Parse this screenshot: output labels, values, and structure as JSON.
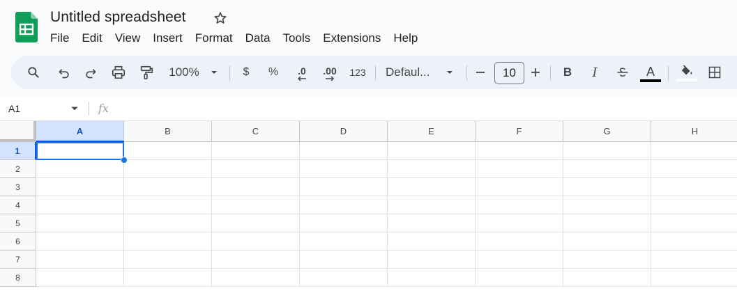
{
  "document": {
    "title": "Untitled spreadsheet"
  },
  "menu": [
    "File",
    "Edit",
    "View",
    "Insert",
    "Format",
    "Data",
    "Tools",
    "Extensions",
    "Help"
  ],
  "toolbar": {
    "zoom": "100%",
    "currency": "$",
    "percent": "%",
    "decrease_decimal": ".0",
    "increase_decimal": ".00",
    "number_format": "123",
    "font": "Defaul...",
    "font_size": "10",
    "minus": "−",
    "plus": "+",
    "bold": "B",
    "italic": "I",
    "text_color": "A"
  },
  "formula_bar": {
    "cell_ref": "A1",
    "fx": "fx",
    "value": ""
  },
  "grid": {
    "columns": [
      "A",
      "B",
      "C",
      "D",
      "E",
      "F",
      "G",
      "H"
    ],
    "rows": [
      "1",
      "2",
      "3",
      "4",
      "5",
      "6",
      "7",
      "8"
    ],
    "active_cell": "A1"
  },
  "colors": {
    "accent": "#1a73e8",
    "logo_green": "#0f9d58",
    "toolbar_bg": "#edf2fa"
  }
}
